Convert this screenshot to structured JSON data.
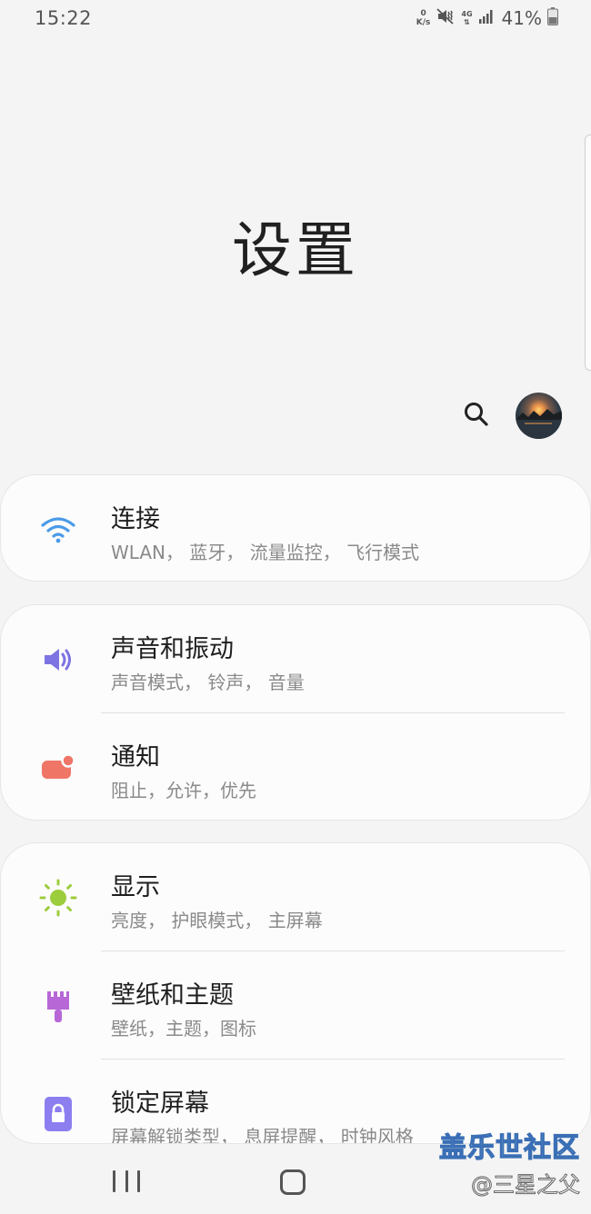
{
  "status_bar": {
    "time": "15:22",
    "net_speed_value": "0",
    "net_speed_unit": "K/s",
    "network_type": "4G",
    "battery_percent": "41%"
  },
  "page": {
    "title": "设置"
  },
  "header_actions": {
    "search_icon": "search-icon",
    "avatar": "profile-avatar"
  },
  "groups": [
    {
      "items": [
        {
          "title": "连接",
          "subtitle": "WLAN， 蓝牙， 流量监控， 飞行模式",
          "icon": "wifi-icon",
          "icon_color": "#4a9be8"
        }
      ]
    },
    {
      "items": [
        {
          "title": "声音和振动",
          "subtitle": "声音模式， 铃声， 音量",
          "icon": "volume-icon",
          "icon_color": "#7e73e3"
        },
        {
          "title": "通知",
          "subtitle": "阻止，允许，优先",
          "icon": "notification-icon",
          "icon_color": "#ef7567"
        }
      ]
    },
    {
      "items": [
        {
          "title": "显示",
          "subtitle": "亮度， 护眼模式， 主屏幕",
          "icon": "brightness-icon",
          "icon_color": "#9ccd3c"
        },
        {
          "title": "壁纸和主题",
          "subtitle": "壁纸，主题，图标",
          "icon": "paint-brush-icon",
          "icon_color": "#b767d6"
        },
        {
          "title": "锁定屏幕",
          "subtitle": "屏幕解锁类型， 息屏提醒， 时钟风格",
          "icon": "lock-icon",
          "icon_color": "#8d7ef0"
        }
      ]
    }
  ],
  "watermark": {
    "line1": "盖乐世社区",
    "line2": "@三星之父"
  },
  "nav_bar": {
    "recents": "recents-icon",
    "home": "home-icon"
  }
}
